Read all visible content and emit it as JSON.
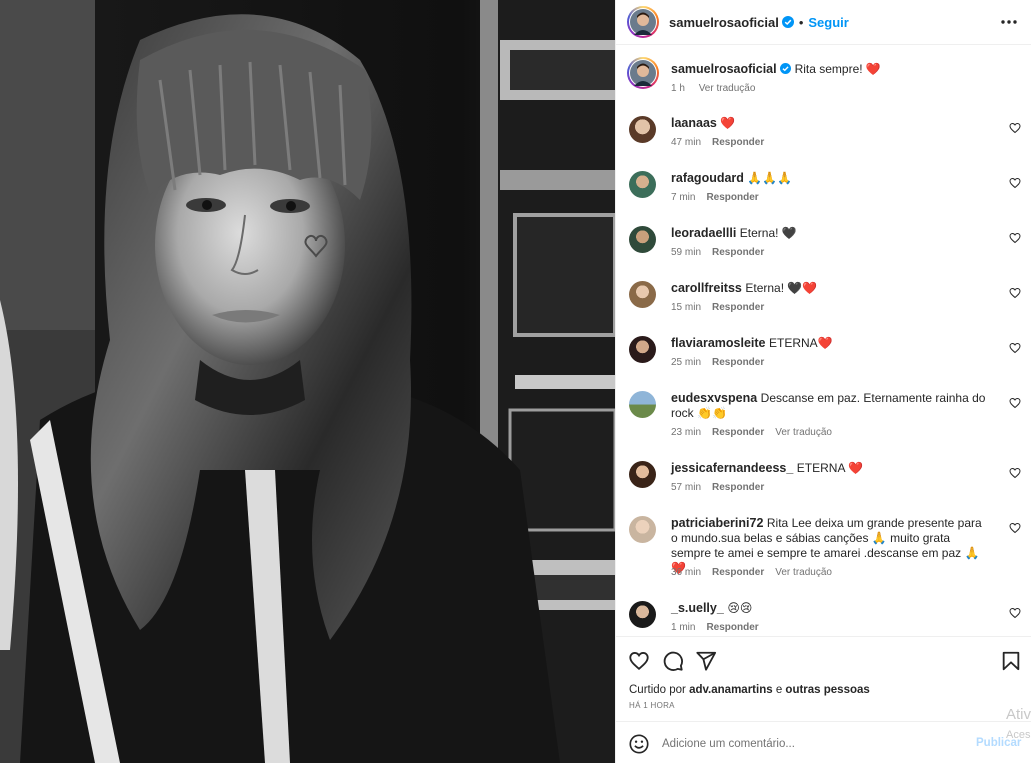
{
  "post": {
    "author": "samuelrosaoficial",
    "follow_label": "Seguir",
    "separator": "•",
    "caption_author": "samuelrosaoficial",
    "caption_text": "Rita sempre! ❤️",
    "caption_time": "1 h",
    "caption_translate": "Ver tradução"
  },
  "comments": [
    {
      "user": "laanaas",
      "text": "❤️",
      "time": "47 min",
      "reply": "Responder",
      "translate": ""
    },
    {
      "user": "rafagoudard",
      "text": "🙏🙏🙏",
      "time": "7 min",
      "reply": "Responder",
      "translate": ""
    },
    {
      "user": "leoradaellli",
      "text": "Eterna! 🖤",
      "time": "59 min",
      "reply": "Responder",
      "translate": ""
    },
    {
      "user": "carollfreitss",
      "text": "Eterna! 🖤❤️",
      "time": "15 min",
      "reply": "Responder",
      "translate": ""
    },
    {
      "user": "flaviaramosleite",
      "text": "ETERNA❤️",
      "time": "25 min",
      "reply": "Responder",
      "translate": ""
    },
    {
      "user": "eudesxvspena",
      "text": "Descanse em paz. Eternamente rainha do rock 👏👏",
      "time": "23 min",
      "reply": "Responder",
      "translate": "Ver tradução"
    },
    {
      "user": "jessicafernandeess_",
      "text": "ETERNA ❤️",
      "time": "57 min",
      "reply": "Responder",
      "translate": ""
    },
    {
      "user": "patriciaberini72",
      "text": "Rita Lee deixa um grande presente para o mundo.sua belas e sábias canções 🙏 muito grata sempre te amei e sempre te amarei .descanse em paz 🙏❤️",
      "time": "36 min",
      "reply": "Responder",
      "translate": "Ver tradução"
    },
    {
      "user": "_s.uelly_",
      "text": "😢😢",
      "time": "1 min",
      "reply": "Responder",
      "translate": ""
    }
  ],
  "likes": {
    "prefix": "Curtido por",
    "user": "adv.anamartins",
    "middle": "e",
    "suffix": "outras pessoas",
    "ago": "HÁ 1 HORA"
  },
  "add_comment": {
    "placeholder": "Adicione um comentário...",
    "publish_label": "Publicar"
  },
  "os_watermark": {
    "line1": "Ativ",
    "line2": "Aces"
  },
  "colors": {
    "link": "#0095f6",
    "publish_disabled": "#b3dbff",
    "heart": "#ed4956",
    "verified": "#0095f6"
  },
  "icons": [
    "more-icon",
    "verified-icon",
    "heart-icon",
    "comment-icon",
    "share-icon",
    "bookmark-icon",
    "emoji-icon"
  ]
}
